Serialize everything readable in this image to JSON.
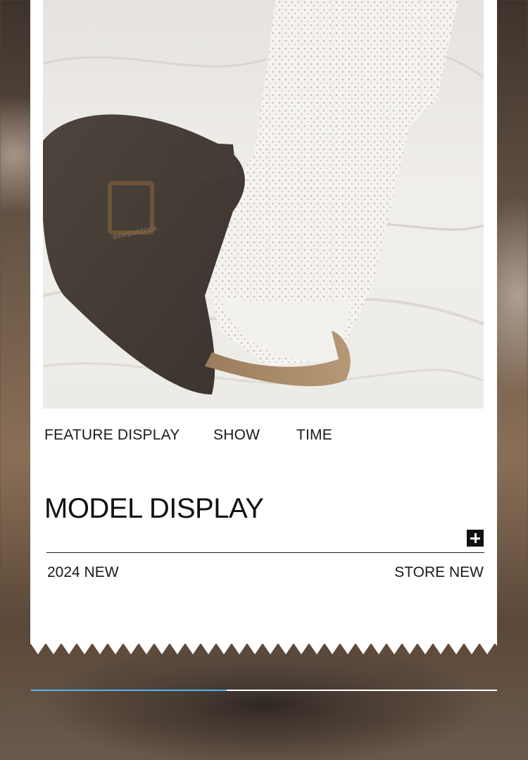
{
  "feature_row": {
    "items": [
      "FEATURE DISPLAY",
      "SHOW",
      "TIME"
    ]
  },
  "model": {
    "title": "MODEL DISPLAY"
  },
  "tags": {
    "left": "2024 NEW",
    "right": "STORE NEW"
  },
  "photo": {
    "buckle_text": "BIRKENSTOCK"
  },
  "icons": {
    "expand": "plus-icon"
  },
  "progress": {
    "fraction": 0.42,
    "fill_color": "#4fb6f2",
    "track_color": "#ffffff"
  }
}
